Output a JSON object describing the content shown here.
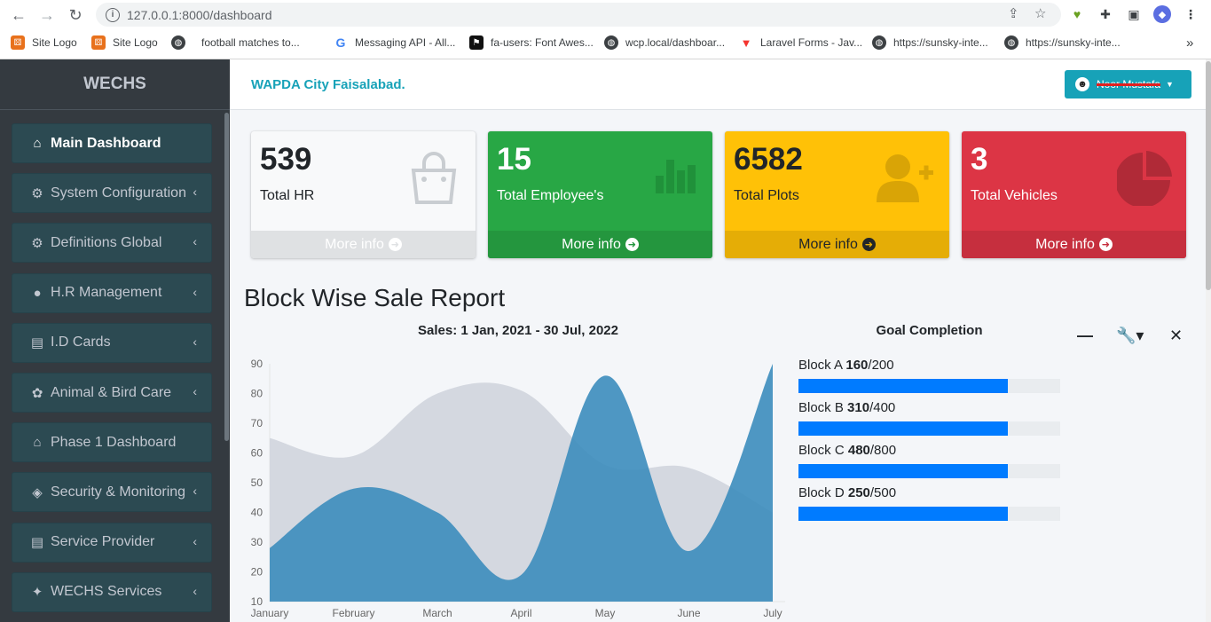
{
  "browser": {
    "url_host": "127.0.0.1",
    "url_path": ":8000/dashboard",
    "bookmarks": [
      {
        "label": "Site Logo",
        "icon": "site-logo-icon"
      },
      {
        "label": "Site Logo",
        "icon": "site-logo-icon"
      },
      {
        "label": "football matches to...",
        "icon": "site-logo-icon"
      },
      {
        "label": "Messaging API - All...",
        "icon": "google-icon"
      },
      {
        "label": "fa-users: Font Awes...",
        "icon": "flag-icon"
      },
      {
        "label": "wcp.local/dashboar...",
        "icon": "globe-icon"
      },
      {
        "label": "Laravel Forms - Jav...",
        "icon": "laravel-icon"
      },
      {
        "label": "https://sunsky-inte...",
        "icon": "globe-icon"
      },
      {
        "label": "https://sunsky-inte...",
        "icon": "globe-icon"
      }
    ],
    "more": "»"
  },
  "sidebar": {
    "brand": "WECHS",
    "items": [
      {
        "label": "Main Dashboard",
        "icon": "home-icon",
        "glyph": "⌂",
        "arrow": ""
      },
      {
        "label": "System Configuration",
        "icon": "users-cog-icon",
        "glyph": "⚙",
        "arrow": "‹"
      },
      {
        "label": "Definitions Global",
        "icon": "cogs-icon",
        "glyph": "⚙",
        "arrow": "‹"
      },
      {
        "label": "H.R Management",
        "icon": "user-icon",
        "glyph": "●",
        "arrow": "‹"
      },
      {
        "label": "I.D Cards",
        "icon": "id-card-icon",
        "glyph": "▤",
        "arrow": "‹"
      },
      {
        "label": "Animal & Bird Care",
        "icon": "bird-icon",
        "glyph": "✿",
        "arrow": "‹"
      },
      {
        "label": "Phase 1 Dashboard",
        "icon": "home-icon",
        "glyph": "⌂",
        "arrow": ""
      },
      {
        "label": "Security & Monitoring",
        "icon": "shield-icon",
        "glyph": "◈",
        "arrow": "‹"
      },
      {
        "label": "Service Provider",
        "icon": "id-card-icon",
        "glyph": "▤",
        "arrow": "‹"
      },
      {
        "label": "WECHS Services",
        "icon": "handshake-icon",
        "glyph": "✦",
        "arrow": "‹"
      }
    ]
  },
  "header": {
    "city": "WAPDA City Faisalabad.",
    "user_name": "Noor Mustafa"
  },
  "stats": [
    {
      "value": "539",
      "label": "Total HR",
      "more": "More info",
      "icon": "shopping-bag-icon",
      "bg": "#f8f9fa",
      "fg": "#212529",
      "foot_bg": "#dfe1e3",
      "foot_fg": "#ffffff",
      "icon_color": "#c9cdd1"
    },
    {
      "value": "15",
      "label": "Total Employee's",
      "more": "More info",
      "icon": "bar-chart-icon",
      "bg": "#28a745",
      "fg": "#ffffff",
      "foot_bg": "#24963e",
      "foot_fg": "#ffffff",
      "icon_color": "#20913a"
    },
    {
      "value": "6582",
      "label": "Total Plots",
      "more": "More info",
      "icon": "user-plus-icon",
      "bg": "#ffc107",
      "fg": "#212529",
      "foot_bg": "#e5ad06",
      "foot_fg": "#212529",
      "icon_color": "#d9a406"
    },
    {
      "value": "3",
      "label": "Total Vehicles",
      "more": "More info",
      "icon": "pie-chart-icon",
      "bg": "#dc3545",
      "fg": "#ffffff",
      "foot_bg": "#c62f3e",
      "foot_fg": "#ffffff",
      "icon_color": "#b02a37"
    }
  ],
  "report": {
    "title": "Block Wise Sale Report",
    "chart_title": "Sales: 1 Jan, 2021 - 30 Jul, 2022",
    "goal_title": "Goal Completion",
    "goals": [
      {
        "name": "Block A",
        "value": "160",
        "total": "/200",
        "fraction": 0.8
      },
      {
        "name": "Block B",
        "value": "310",
        "total": "/400",
        "fraction": 0.8
      },
      {
        "name": "Block C",
        "value": "480",
        "total": "/800",
        "fraction": 0.8
      },
      {
        "name": "Block D",
        "value": "250",
        "total": "/500",
        "fraction": 0.8
      }
    ]
  },
  "chart_data": {
    "type": "area",
    "title": "Sales: 1 Jan, 2021 - 30 Jul, 2022",
    "categories": [
      "January",
      "February",
      "March",
      "April",
      "May",
      "June",
      "July"
    ],
    "ylim": [
      10,
      90
    ],
    "yticks": [
      10,
      20,
      30,
      40,
      50,
      60,
      70,
      80,
      90
    ],
    "series": [
      {
        "color": "#d2d6de",
        "values": [
          65,
          59,
          80,
          81,
          56,
          55,
          40
        ]
      },
      {
        "color": "#3c8dbc",
        "values": [
          28,
          48,
          40,
          19,
          86,
          27,
          90
        ]
      }
    ],
    "grid": false
  }
}
